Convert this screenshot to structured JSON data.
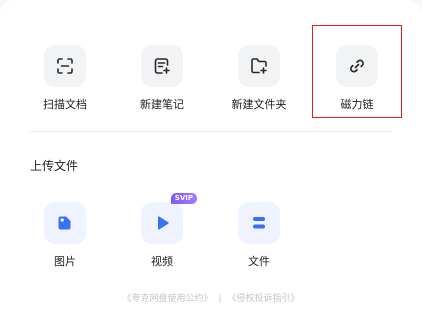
{
  "actions": [
    {
      "label": "扫描文档",
      "icon": "scan-icon"
    },
    {
      "label": "新建笔记",
      "icon": "new-note-icon"
    },
    {
      "label": "新建文件夹",
      "icon": "new-folder-icon"
    },
    {
      "label": "磁力链",
      "icon": "magnet-link-icon"
    }
  ],
  "upload": {
    "title": "上传文件",
    "items": [
      {
        "label": "图片",
        "icon": "image-icon"
      },
      {
        "label": "视频",
        "icon": "video-icon",
        "badge": "SVIP"
      },
      {
        "label": "文件",
        "icon": "file-icon"
      }
    ]
  },
  "footer": {
    "agreement": "《夸克网盘使用公约》",
    "separator": "|",
    "guide": "《侵权投诉指引》"
  },
  "colors": {
    "accent": "#3a6ff7",
    "highlight": "#e02020",
    "svip": "#8a66f8"
  }
}
